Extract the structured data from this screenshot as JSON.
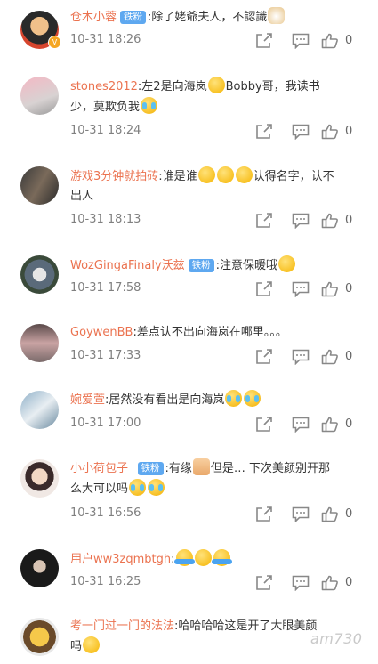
{
  "comments": [
    {
      "username": "仓木小蓉",
      "fan_badge": "铁粉",
      "verified_badge": "V",
      "text": ":除了姥爺夫人，不認識",
      "emoji": [
        "cat"
      ],
      "time": "10-31 18:26",
      "likes": "0"
    },
    {
      "username": "stones2012",
      "text_a": ":左2是向海岚",
      "text_b": "Bobby哥，我读书少，莫欺负我",
      "time": "10-31 18:24",
      "likes": "0"
    },
    {
      "username": "游戏3分钟就拍砖",
      "text_a": ":谁是谁",
      "text_b": "认得名字，认不出人",
      "time": "10-31 18:13",
      "likes": "0"
    },
    {
      "username": "WozGingaFinaly沃兹",
      "fan_badge": "铁粉",
      "text": ":注意保暖哦",
      "time": "10-31 17:58",
      "likes": "0"
    },
    {
      "username": "GoywenBB",
      "text": ":差点认不出向海岚在哪里。。。",
      "time": "10-31 17:33",
      "likes": "0"
    },
    {
      "username": "婉爱萱",
      "text": ":居然没有看出是向海岚",
      "time": "10-31 17:00",
      "likes": "0"
    },
    {
      "username": "小小荷包子_",
      "fan_badge": "铁粉",
      "text_a": ":有缘",
      "text_b": "但是… 下次美颜别开那么大可以吗",
      "time": "10-31 16:56",
      "likes": "0"
    },
    {
      "username": "用户ww3zqmbtgh",
      "text": ":",
      "time": "10-31 16:25",
      "likes": "0"
    },
    {
      "username": "考一门过一门的法法",
      "text_a": ":哈哈哈哈这是开了大眼美颜",
      "text_b": "吗"
    }
  ],
  "watermark": "am730",
  "colors": {
    "username": "#eb7350",
    "fan_badge": "#5ea8f0",
    "meta": "#808080"
  }
}
